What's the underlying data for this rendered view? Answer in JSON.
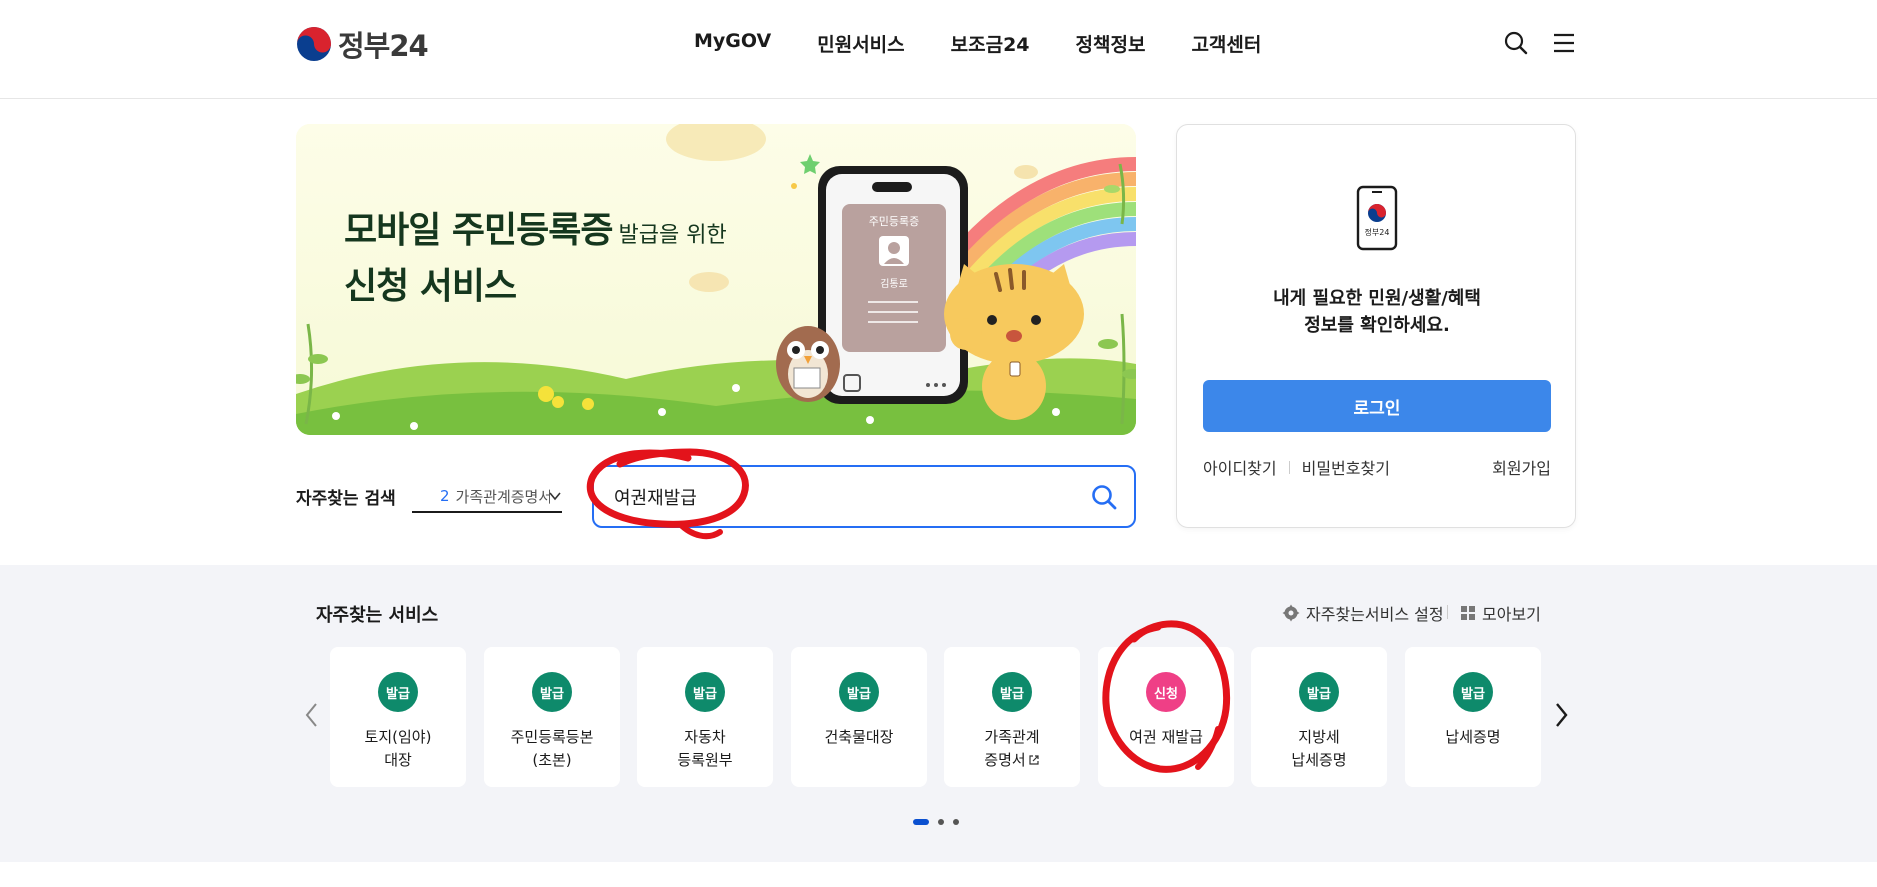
{
  "header": {
    "logo_text": "정부24",
    "nav": [
      "MyGOV",
      "민원서비스",
      "보조금24",
      "정책정보",
      "고객센터"
    ]
  },
  "banner": {
    "title_line1": "모바일 주민등록증",
    "title_line1_small": "발급을 위한",
    "title_line2": "신청 서비스",
    "card_title": "주민등록증",
    "card_name": "김통로"
  },
  "search": {
    "label": "자주찾는 검색",
    "frequent_rank": "2",
    "frequent_text": "가족관계증명서",
    "input_value": "여권재발급"
  },
  "login": {
    "icon_text": "정부24",
    "message_line1": "내게 필요한 민원/생활/혜택",
    "message_line2": "정보를 확인하세요.",
    "button": "로그인",
    "find_id": "아이디찾기",
    "find_pw": "비밀번호찾기",
    "signup": "회원가입"
  },
  "services": {
    "title": "자주찾는 서비스",
    "settings": "자주찾는서비스 설정",
    "collect": "모아보기",
    "cards": [
      {
        "badge": "발급",
        "label": "토지(임야)\n대장"
      },
      {
        "badge": "발급",
        "label": "주민등록등본\n(초본)"
      },
      {
        "badge": "발급",
        "label": "자동차\n등록원부"
      },
      {
        "badge": "발급",
        "label": "건축물대장"
      },
      {
        "badge": "발급",
        "label": "가족관계\n증명서"
      },
      {
        "badge": "신청",
        "label": "여권 재발급"
      },
      {
        "badge": "발급",
        "label": "지방세\n납세증명"
      },
      {
        "badge": "발급",
        "label": "납세증명"
      }
    ],
    "pagination_active": 1,
    "pagination_total": 3
  },
  "colors": {
    "accent_blue": "#256ef4",
    "login_button": "#3c87ea",
    "badge_issue": "#0e8a6b",
    "badge_apply": "#ef3f86",
    "annotation_red": "#e3131b"
  }
}
